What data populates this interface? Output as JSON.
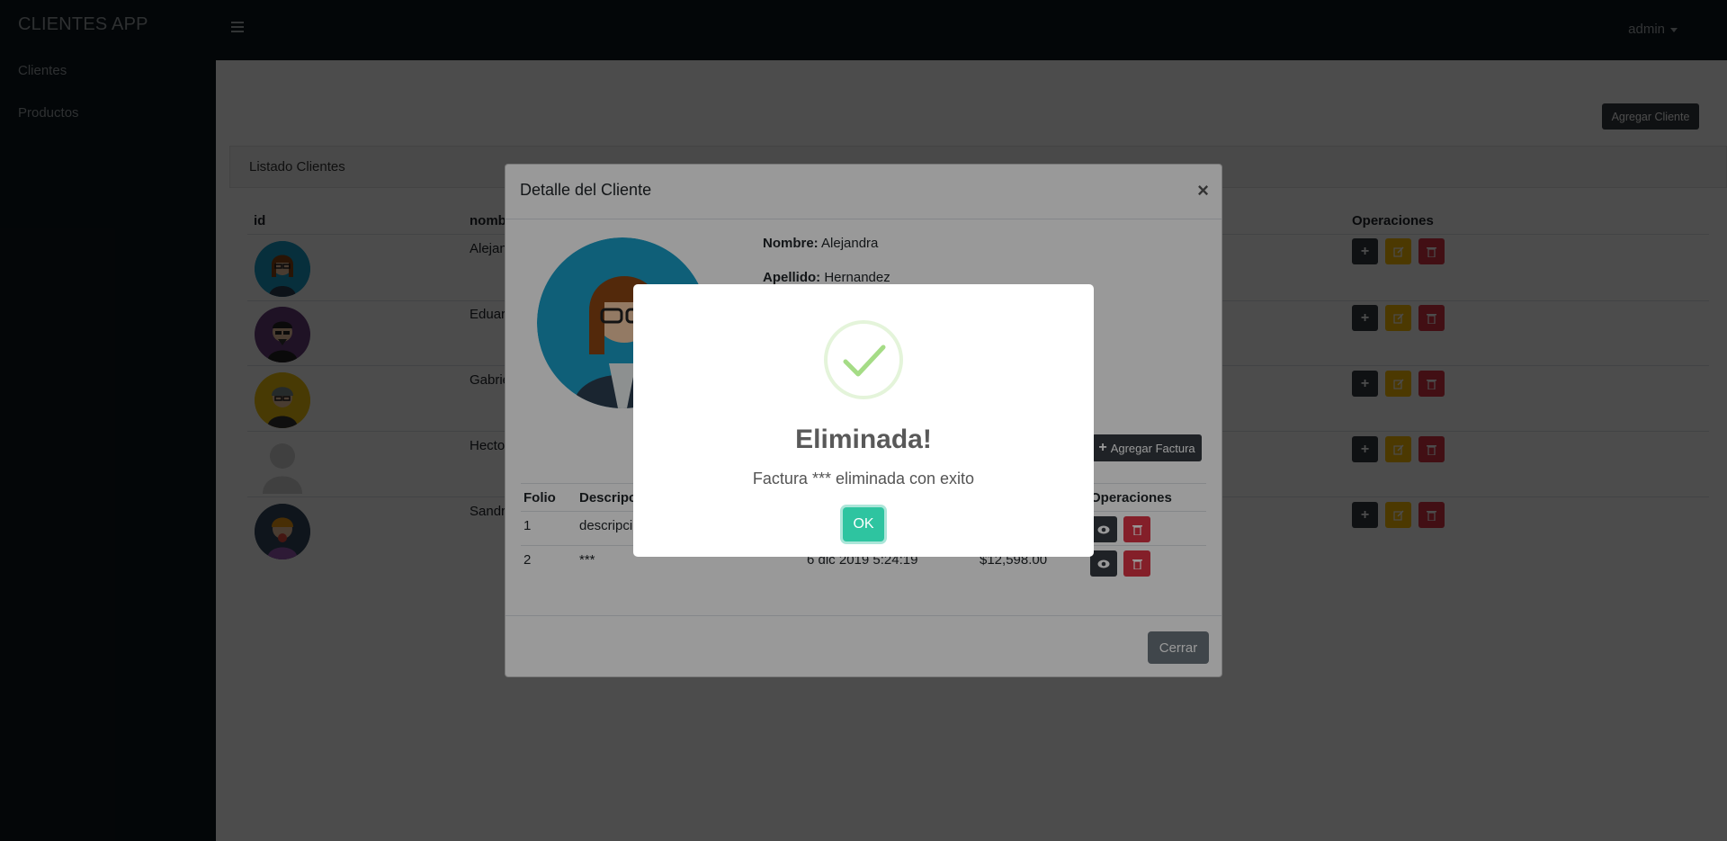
{
  "app": {
    "brand": "CLIENTES APP"
  },
  "sidebar": {
    "items": [
      {
        "label": "Clientes"
      },
      {
        "label": "Productos"
      }
    ]
  },
  "topbar": {
    "user": "admin"
  },
  "main": {
    "add_client_label": "Agregar Cliente",
    "card_title": "Listado Clientes",
    "columns": {
      "id": "id",
      "name": "nomb",
      "operations": "Operaciones"
    },
    "rows": [
      {
        "name": "Alejan"
      },
      {
        "name": "Eduar"
      },
      {
        "name": "Gabrie"
      },
      {
        "name": "Hecto"
      },
      {
        "name": "Sandr"
      }
    ]
  },
  "modal": {
    "title": "Detalle del Cliente",
    "close": "×",
    "fields": {
      "nombre_label": "Nombre:",
      "nombre_value": "Alejandra",
      "apellido_label": "Apellido:",
      "apellido_value": "Hernandez"
    },
    "add_invoice_label": "Agregar Factura",
    "invoice_columns": {
      "folio": "Folio",
      "desc": "Descripc",
      "ops": "Operaciones"
    },
    "invoices": [
      {
        "folio": "1",
        "desc": "descripci",
        "date": "",
        "total": ""
      },
      {
        "folio": "2",
        "desc": "***",
        "date": "6 dic 2019 5:24:19",
        "total": "$12,598.00"
      }
    ],
    "close_button": "Cerrar"
  },
  "alert": {
    "title": "Eliminada!",
    "text": "Factura *** eliminada con exito",
    "ok": "OK"
  },
  "colors": {
    "dark": "#343a40",
    "warning": "#ffc107",
    "danger": "#dc3545",
    "success_check": "#a5dc86",
    "ok_button": "#2ec4a0"
  }
}
